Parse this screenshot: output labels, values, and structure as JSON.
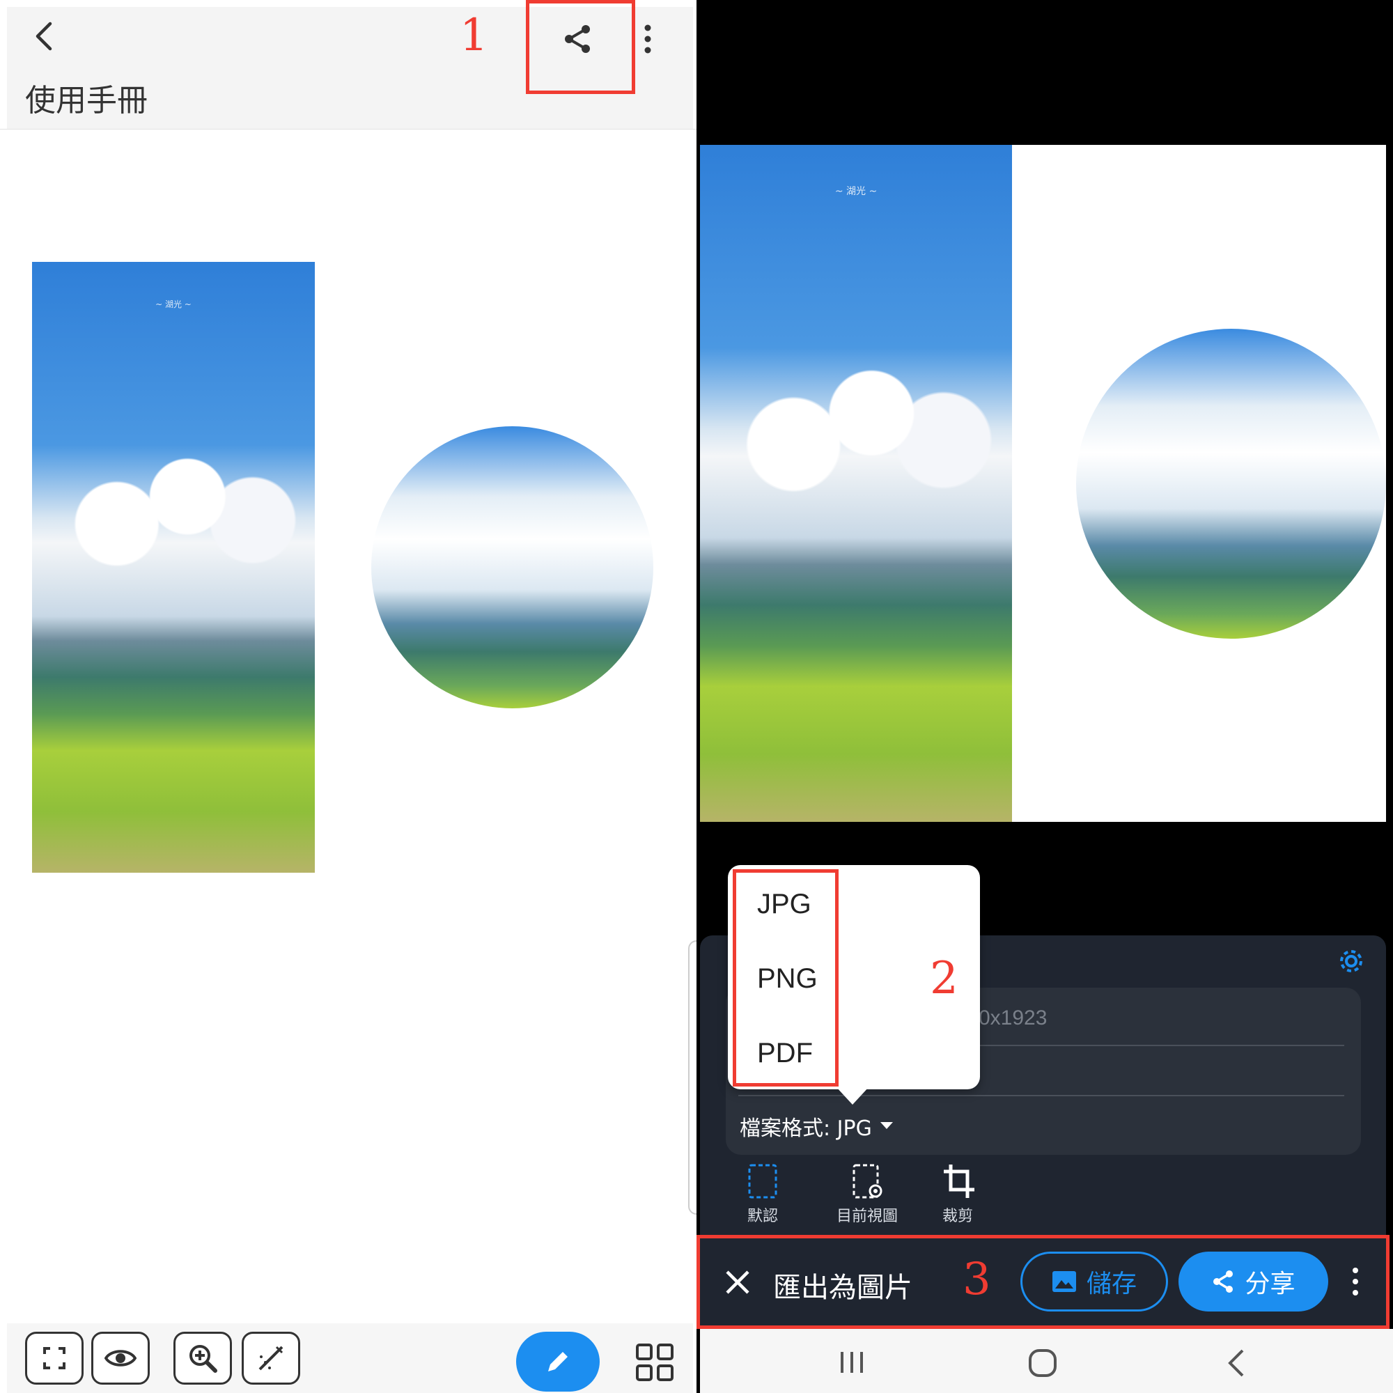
{
  "left_screen": {
    "title": "使用手冊",
    "image_caption": "~ 湖光 ~",
    "step1": "1",
    "icons": {
      "back": "back-arrow-icon",
      "share": "share-icon",
      "more": "more-vert-icon",
      "toolbar": [
        "fullscreen-icon",
        "eye-icon",
        "zoom-in-icon",
        "magic-wand-icon"
      ],
      "edit": "pencil-icon",
      "grid": "grid-icon"
    }
  },
  "right_screen": {
    "image_caption": "~ 湖光 ~",
    "format_options": [
      "JPG",
      "PNG",
      "PDF"
    ],
    "step2": "2",
    "size_value": "0x1923",
    "file_format_label": "檔案格式: JPG",
    "modes": [
      "默認",
      "目前視圖",
      "裁剪"
    ],
    "step3": "3",
    "export_title": "匯出為圖片",
    "save_label": "儲存",
    "share_label": "分享",
    "colors": {
      "accent": "#1c8ef0",
      "annotation": "#f03c32",
      "panel": "#1f2530"
    }
  }
}
